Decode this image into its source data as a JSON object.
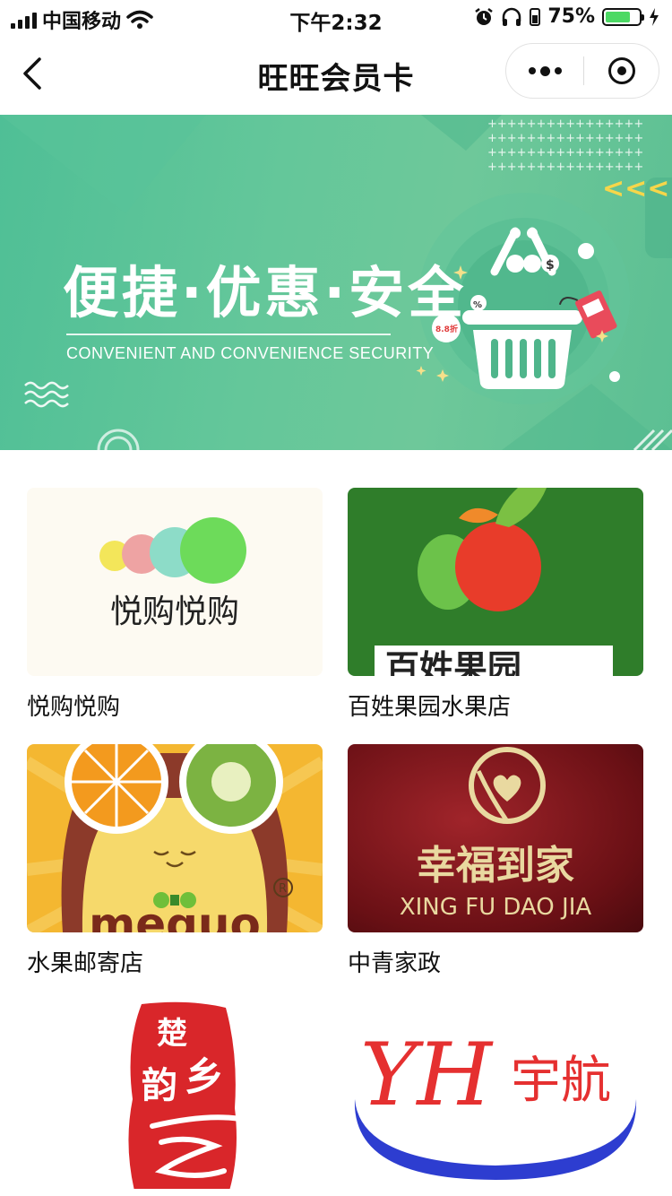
{
  "status_bar": {
    "carrier": "中国移动",
    "time": "下午2:32",
    "battery_percent": "75%",
    "battery_level": 0.75
  },
  "nav": {
    "title": "旺旺会员卡"
  },
  "banner": {
    "title": "便捷·优惠·安全",
    "subtitle": "CONVENIENT AND CONVENIENCE SECURITY",
    "badge": "8.8折",
    "arrows": "<<<"
  },
  "stores": [
    {
      "name": "悦购悦购",
      "logo_text": "悦购悦购"
    },
    {
      "name": "百姓果园水果店",
      "logo_text": "百姓果园"
    },
    {
      "name": "水果邮寄店",
      "logo_text": "meguo"
    },
    {
      "name": "中青家政",
      "logo_text": "幸福到家",
      "logo_subtext": "XING FU DAO JIA"
    },
    {
      "name": "",
      "logo_text": "楚韵乡"
    },
    {
      "name": "",
      "logo_text": "YH",
      "logo_subtext": "宇航"
    }
  ],
  "colors": {
    "banner_green": "#5cbf93",
    "battery_green": "#4cd964",
    "apple_bg": "#2f7d2a",
    "seal_red": "#d9262a"
  }
}
